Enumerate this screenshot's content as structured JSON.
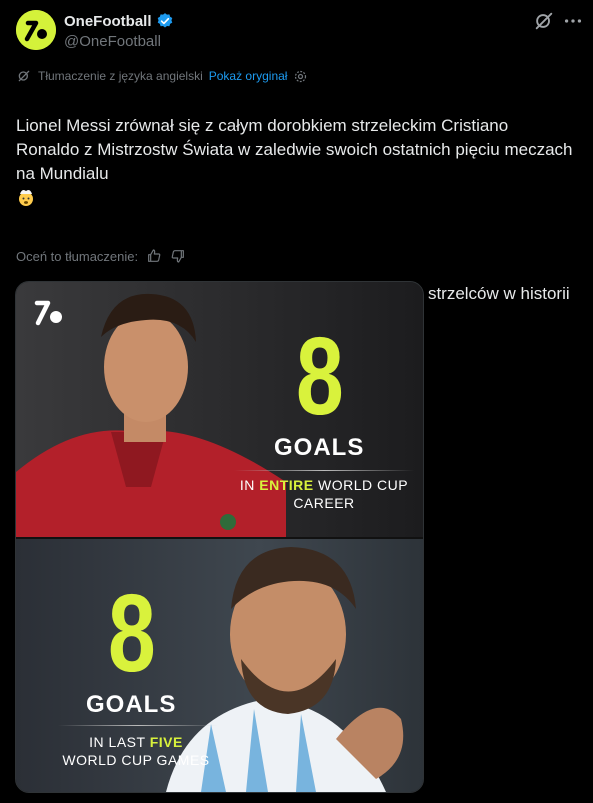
{
  "author": {
    "display_name": "OneFootball",
    "handle": "@OneFootball"
  },
  "translation": {
    "note": "Tłumaczenie z języka angielski",
    "show_original": "Pokaż oryginał"
  },
  "tweet": {
    "paragraph1": "Lionel Messi zrównał się z całym dorobkiem strzeleckim Cristiano Ronaldo z Mistrzostw Świata w zaledwie swoich ostatnich pięciu meczach na Mundialu",
    "paragraph2": "On jest teraz również współliderem wśród najlepszych strzelców w historii Mistrzostw Świata"
  },
  "rate": {
    "label": "Oceń to tłumaczenie:"
  },
  "media": {
    "top": {
      "number": "8",
      "goals": "GOALS",
      "line1_pre": "IN ",
      "line1_hl": "ENTIRE",
      "line1_post": " WORLD CUP",
      "line2": "CAREER"
    },
    "bottom": {
      "number": "8",
      "goals": "GOALS",
      "line1_pre": "IN LAST ",
      "line1_hl": "FIVE",
      "line2": "WORLD CUP GAMES"
    }
  },
  "colors": {
    "brand": "#d9f23c",
    "link": "#1d9bf0",
    "verified": "#1d9bf0",
    "muted": "#71767b"
  }
}
